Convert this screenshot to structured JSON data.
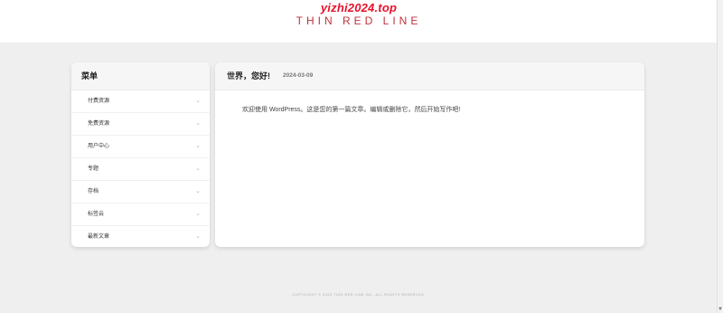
{
  "header": {
    "watermark": "yizhi2024.top",
    "logo_text": "THIN RED LINE"
  },
  "menu": {
    "title": "菜单",
    "items": [
      {
        "label": "付费资源"
      },
      {
        "label": "免费资源"
      },
      {
        "label": "用户中心"
      },
      {
        "label": "专题"
      },
      {
        "label": "存档"
      },
      {
        "label": "标签云"
      },
      {
        "label": "最新文章"
      }
    ]
  },
  "post": {
    "title": "世界，您好!",
    "date": "2024-03-09",
    "body": "欢迎使用 WordPress。这是您的第一篇文章。编辑或删除它，然后开始写作吧!"
  },
  "footer": {
    "copyright": "COPYRIGHT © 2022 THIN RED LINE INC. ALL RIGHTS RESERVED."
  },
  "colors": {
    "brand_red": "#c0313b",
    "watermark_red": "#e8102a",
    "page_bg": "#efefef"
  }
}
